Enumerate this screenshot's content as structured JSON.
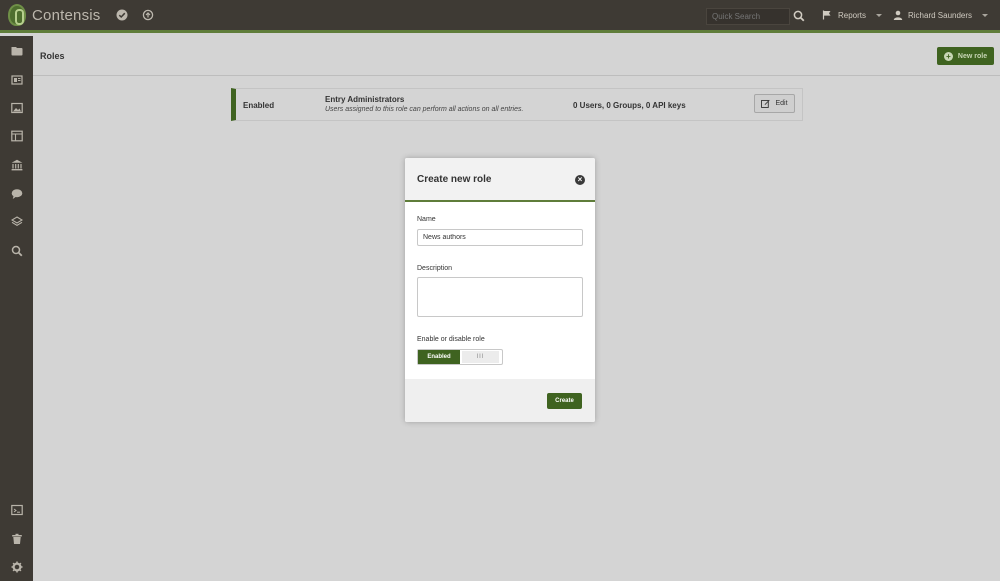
{
  "app": {
    "name": "Contensis"
  },
  "topbar": {
    "icons": [
      "check-circle-icon",
      "sync-icon"
    ],
    "search_placeholder": "Quick Search",
    "reports_label": "Reports",
    "user_name": "Richard Saunders"
  },
  "sidebar": {
    "icons": [
      "folder-icon",
      "entries-icon",
      "image-icon",
      "layout-icon",
      "bank-icon",
      "comment-icon",
      "layers-icon",
      "search-icon",
      "console-icon",
      "trash-icon",
      "gear-icon"
    ]
  },
  "page": {
    "title": "Roles",
    "new_button_label": "New role"
  },
  "roles": [
    {
      "status": "Enabled",
      "name": "Entry Administrators",
      "description": "Users assigned to this role can perform all actions on all entries.",
      "counts": "0 Users, 0 Groups, 0 API keys",
      "edit_label": "Edit"
    }
  ],
  "modal": {
    "title": "Create new role",
    "name_label": "Name",
    "name_value": "News authors",
    "description_label": "Description",
    "description_value": "",
    "toggle_label": "Enable or disable role",
    "toggle_on_text": "Enabled",
    "toggle_handle_text": "III",
    "create_label": "Create"
  },
  "colors": {
    "topbar": "#3e3a34",
    "accent": "#3f6320",
    "accent_line": "#5f7d3a",
    "page_background": "#d4d4d4"
  }
}
